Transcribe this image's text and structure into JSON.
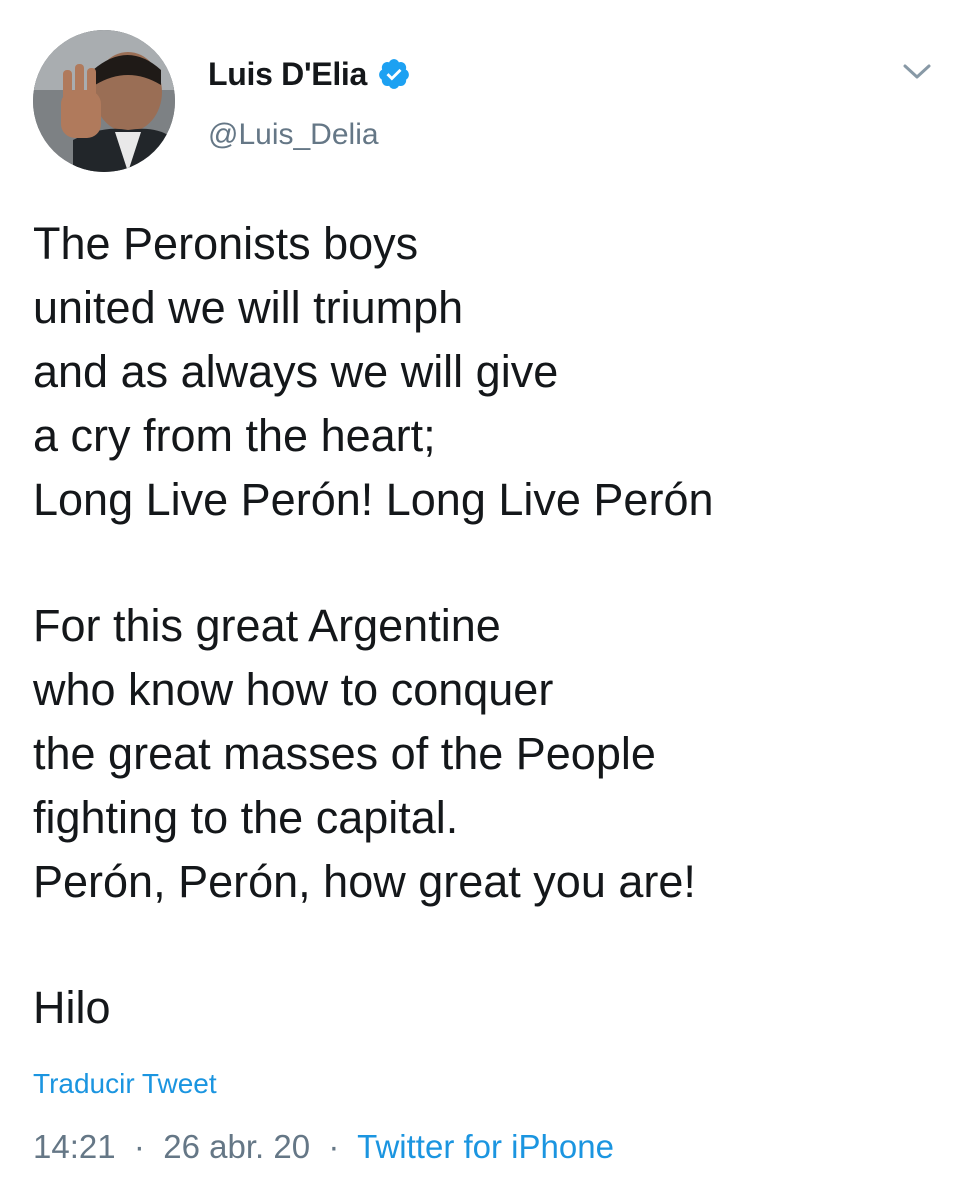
{
  "author": {
    "display_name": "Luis D'Elia",
    "handle": "@Luis_Delia",
    "verified": true
  },
  "tweet": {
    "paragraphs": [
      [
        "The Peronists boys",
        "united we will triumph",
        "and as always we will give",
        "a cry from the heart;",
        "Long Live Perón! Long Live Perón"
      ],
      [
        "For this great Argentine",
        "who know how to conquer",
        "the great masses of the People",
        "fighting to the capital.",
        "Perón, Perón, how great you are!"
      ],
      [
        "Hilo"
      ]
    ]
  },
  "translate_label": "Traducir Tweet",
  "meta": {
    "time": "14:21",
    "separator": "·",
    "date": "26 abr. 20",
    "source": "Twitter for iPhone"
  },
  "icons": {
    "verified": "verified-badge-icon",
    "menu": "chevron-down-icon"
  },
  "colors": {
    "link": "#1b95e0",
    "verified": "#1da1f2",
    "secondary_text": "#657786",
    "primary_text": "#14171a"
  }
}
